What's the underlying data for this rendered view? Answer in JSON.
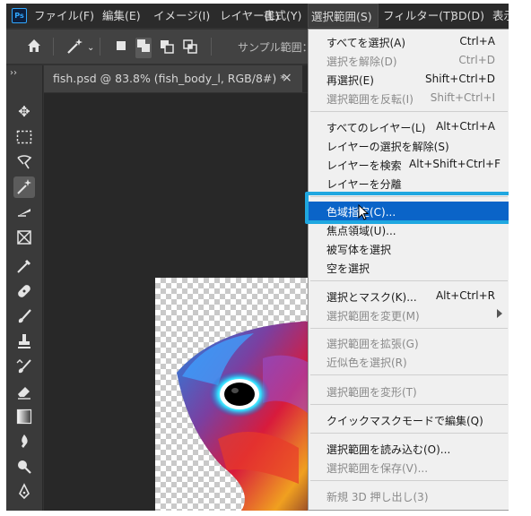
{
  "app": {
    "logo": "Ps"
  },
  "menubar": {
    "items": [
      "ファイル(F)",
      "編集(E)",
      "イメージ(I)",
      "レイヤー(L)",
      "書式(Y)",
      "選択範囲(S)",
      "フィルター(T)",
      "3D(D)",
      "表示"
    ],
    "active": "選択範囲(S)"
  },
  "options": {
    "home_icon": "home-icon",
    "tool_icon": "magic-wand-icon",
    "mode_icons": [
      "new-selection-icon",
      "add-selection-icon",
      "subtract-selection-icon",
      "intersect-selection-icon"
    ],
    "sample_label": "サンプル範囲："
  },
  "document": {
    "tab_title": "fish.psd @ 83.8% (fish_body_l, RGB/8#) *",
    "close_symbol": "×"
  },
  "toolbar": {
    "collapse": "››",
    "tools": [
      "move-icon",
      "marquee-icon",
      "lasso-icon",
      "magic-wand-icon",
      "crop-icon",
      "frame-icon",
      "eyedropper-icon",
      "healing-brush-icon",
      "brush-icon",
      "clone-stamp-icon",
      "history-brush-icon",
      "eraser-icon",
      "gradient-icon",
      "blur-icon",
      "dodge-icon",
      "pen-icon"
    ],
    "selected": "magic-wand-icon"
  },
  "select_menu": {
    "items": [
      {
        "label": "すべてを選択(A)",
        "shortcut": "Ctrl+A",
        "disabled": false
      },
      {
        "label": "選択を解除(D)",
        "shortcut": "Ctrl+D",
        "disabled": true
      },
      {
        "label": "再選択(E)",
        "shortcut": "Shift+Ctrl+D",
        "disabled": false
      },
      {
        "label": "選択範囲を反転(I)",
        "shortcut": "Shift+Ctrl+I",
        "disabled": true
      },
      {
        "label": "すべてのレイヤー(L)",
        "shortcut": "Alt+Ctrl+A",
        "disabled": false
      },
      {
        "label": "レイヤーの選択を解除(S)",
        "shortcut": "",
        "disabled": false
      },
      {
        "label": "レイヤーを検索",
        "shortcut": "Alt+Shift+Ctrl+F",
        "disabled": false
      },
      {
        "label": "レイヤーを分離",
        "shortcut": "",
        "disabled": false
      },
      {
        "label": "色域指定(C)...",
        "shortcut": "",
        "disabled": false,
        "highlighted": true
      },
      {
        "label": "焦点領域(U)...",
        "shortcut": "",
        "disabled": false
      },
      {
        "label": "被写体を選択",
        "shortcut": "",
        "disabled": false
      },
      {
        "label": "空を選択",
        "shortcut": "",
        "disabled": false
      },
      {
        "label": "選択とマスク(K)...",
        "shortcut": "Alt+Ctrl+R",
        "disabled": false
      },
      {
        "label": "選択範囲を変更(M)",
        "shortcut": "",
        "disabled": true,
        "submenu": true
      },
      {
        "label": "選択範囲を拡張(G)",
        "shortcut": "",
        "disabled": true
      },
      {
        "label": "近似色を選択(R)",
        "shortcut": "",
        "disabled": true
      },
      {
        "label": "選択範囲を変形(T)",
        "shortcut": "",
        "disabled": true
      },
      {
        "label": "クイックマスクモードで編集(Q)",
        "shortcut": "",
        "disabled": false
      },
      {
        "label": "選択範囲を読み込む(O)...",
        "shortcut": "",
        "disabled": false
      },
      {
        "label": "選択範囲を保存(V)...",
        "shortcut": "",
        "disabled": true
      },
      {
        "label": "新規 3D 押し出し(3)",
        "shortcut": "",
        "disabled": true
      }
    ]
  },
  "colors": {
    "highlight": "#0a64c8",
    "focus_outline": "#1fa7e0",
    "menu_bg": "#f0f0f0",
    "app_bg": "#323232"
  }
}
